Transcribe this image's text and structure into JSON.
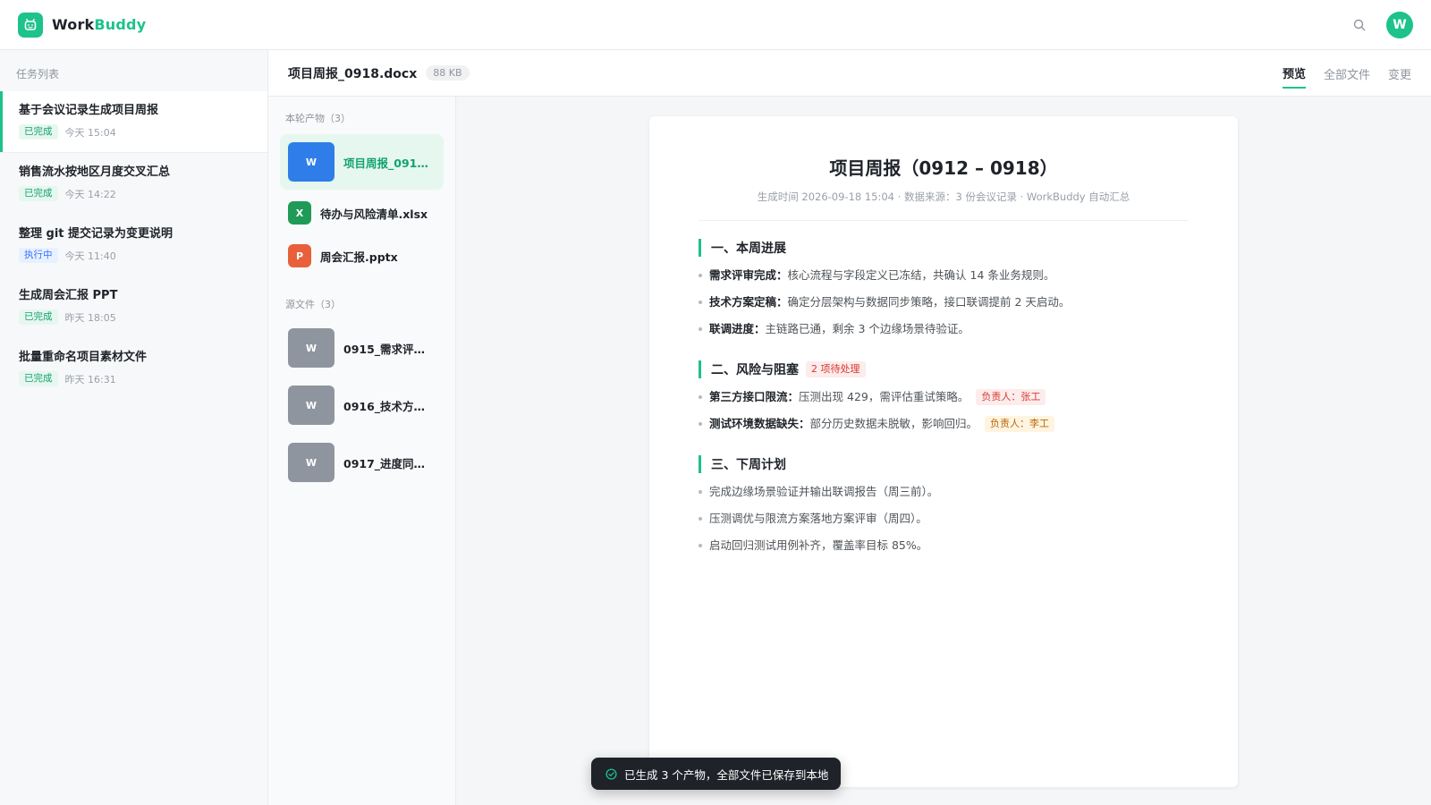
{
  "app": {
    "brand_part1": "Work",
    "brand_part2": "Buddy",
    "user_initial": "W",
    "accent_color": "#1ec28b"
  },
  "sidebar": {
    "title": "任务列表",
    "tasks": [
      {
        "title": "基于会议记录生成项目周报",
        "status": "已完成",
        "time": "今天 15:04"
      },
      {
        "title": "销售流水按地区月度交叉汇总",
        "status": "已完成",
        "time": "今天 14:22"
      },
      {
        "title": "整理 git 提交记录为变更说明",
        "status": "执行中",
        "time": "今天 11:40"
      },
      {
        "title": "生成周会汇报 PPT",
        "status": "已完成",
        "time": "昨天 18:05"
      },
      {
        "title": "批量重命名项目素材文件",
        "status": "已完成",
        "time": "昨天 16:31"
      }
    ]
  },
  "filebar": {
    "name": "项目周报_0918.docx",
    "size": "88 KB",
    "tabs": [
      "预览",
      "全部文件",
      "变更"
    ]
  },
  "files": {
    "outputs_title": "本轮产物（3）",
    "outputs": [
      {
        "icon": "W",
        "name": "项目周报_0918...."
      },
      {
        "icon": "X",
        "name": "待办与风险清单.xlsx"
      },
      {
        "icon": "P",
        "name": "周会汇报.pptx"
      }
    ],
    "sources_title": "源文件（3）",
    "sources": [
      {
        "icon": "W",
        "name": "0915_需求评审...."
      },
      {
        "icon": "W",
        "name": "0916_技术方案...."
      },
      {
        "icon": "W",
        "name": "0917_进度同步...."
      }
    ]
  },
  "doc": {
    "title": "项目周报（0912 – 0918）",
    "subtitle": "生成时间 2026-09-18 15:04 · 数据来源：3 份会议记录 · WorkBuddy 自动汇总",
    "s1": {
      "heading": "一、本周进展",
      "items": [
        {
          "label": "需求评审完成：",
          "text": "核心流程与字段定义已冻结，共确认 14 条业务规则。"
        },
        {
          "label": "技术方案定稿：",
          "text": "确定分层架构与数据同步策略，接口联调提前 2 天启动。"
        },
        {
          "label": "联调进度：",
          "text": "主链路已通，剩余 3 个边缘场景待验证。"
        }
      ]
    },
    "s2": {
      "heading": "二、风险与阻塞",
      "tag": "2 项待处理",
      "items": [
        {
          "label": "第三方接口限流：",
          "text": "压测出现 429，需评估重试策略。",
          "owner": "负责人：张工"
        },
        {
          "label": "测试环境数据缺失：",
          "text": "部分历史数据未脱敏，影响回归。",
          "owner": "负责人：李工"
        }
      ]
    },
    "s3": {
      "heading": "三、下周计划",
      "items": [
        "完成边缘场景验证并输出联调报告（周三前）。",
        "压测调优与限流方案落地方案评审（周四）。",
        "启动回归测试用例补齐，覆盖率目标 85%。"
      ]
    }
  },
  "toast": {
    "text": "已生成 3 个产物，全部文件已保存到本地"
  }
}
